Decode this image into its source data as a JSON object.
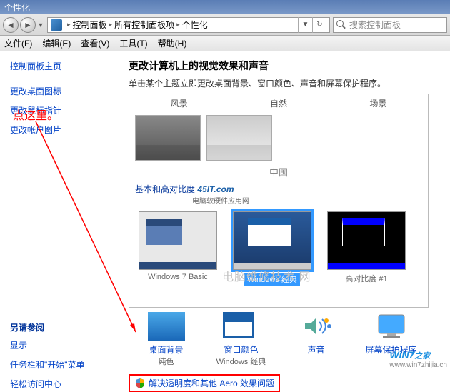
{
  "titlebar": {
    "title": "个性化"
  },
  "addressbar": {
    "crumb1": "控制面板",
    "crumb2": "所有控制面板项",
    "crumb3": "个性化"
  },
  "search": {
    "placeholder": "搜索控制面板"
  },
  "menu": {
    "file": "文件(F)",
    "edit": "编辑(E)",
    "view": "查看(V)",
    "tools": "工具(T)",
    "help": "帮助(H)"
  },
  "sidebar": {
    "home": "控制面板主页",
    "desktop_icons": "更改桌面图标",
    "mouse_pointers": "更改鼠标指针",
    "account_picture": "更改帐户图片",
    "see_also": "另请参阅",
    "display": "显示",
    "taskbar": "任务栏和\"开始\"菜单",
    "ease": "轻松访问中心"
  },
  "main": {
    "heading": "更改计算机上的视觉效果和声音",
    "subtitle": "单击某个主题立即更改桌面背景、窗口颜色、声音和屏幕保护程序。",
    "cat_scenery": "风景",
    "cat_nature": "自然",
    "cat_scene": "场景",
    "cn_label": "中国",
    "section_basic": "基本和高对比度",
    "wm_domain": "45IT.com",
    "wm_tagline": "电脑软硬件应用网",
    "wm_center": "电脑维修技术 网",
    "theme_w7basic": "Windows 7 Basic",
    "theme_classic": "Windows 经典",
    "theme_hc1": "高对比度 #1",
    "bottom": {
      "bg_title": "桌面背景",
      "bg_sub": "纯色",
      "color_title": "窗口颜色",
      "color_sub": "Windows 经典",
      "sound_title": "声音",
      "sound_sub": "",
      "ss_title": "屏幕保护程序",
      "ss_sub": ""
    },
    "troubleshoot": "解决透明度和其他 Aero 效果问题"
  },
  "annotation": {
    "label": "点这里。"
  },
  "footer": {
    "brand": "WiN7",
    "suffix": "之家",
    "url": "www.win7zhijia.cn"
  }
}
